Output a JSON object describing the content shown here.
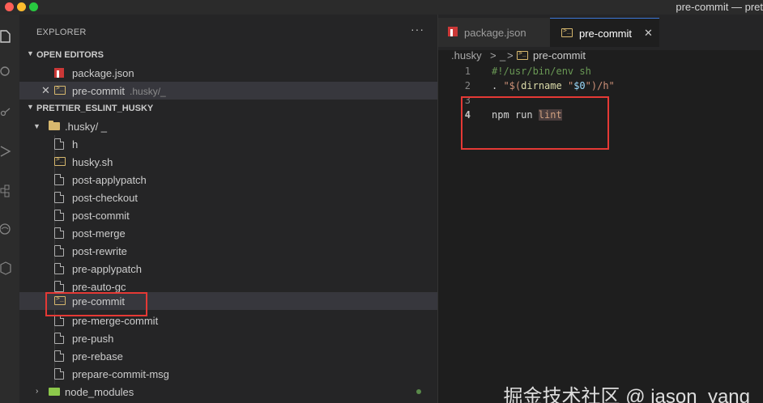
{
  "window": {
    "title": "pre-commit — pret"
  },
  "sidebar": {
    "header": "EXPLORER",
    "more_label": "···",
    "open_editors_label": "OPEN EDITORS",
    "open_editors": [
      {
        "name": "package.json",
        "icon": "npm-icon",
        "description": ""
      },
      {
        "name": "pre-commit",
        "icon": "terminal-file-icon",
        "description": ".husky/_"
      }
    ],
    "workspace_label": "PRETTIER_ESLINT_HUSKY",
    "folder": {
      "name": ".husky",
      "path_suffix": "/ _"
    },
    "files": [
      {
        "name": "h",
        "icon": "file-icon"
      },
      {
        "name": "husky.sh",
        "icon": "terminal-file-icon"
      },
      {
        "name": "post-applypatch",
        "icon": "file-icon"
      },
      {
        "name": "post-checkout",
        "icon": "file-icon"
      },
      {
        "name": "post-commit",
        "icon": "file-icon"
      },
      {
        "name": "post-merge",
        "icon": "file-icon"
      },
      {
        "name": "post-rewrite",
        "icon": "file-icon"
      },
      {
        "name": "pre-applypatch",
        "icon": "file-icon"
      },
      {
        "name": "pre-auto-gc",
        "icon": "file-icon"
      },
      {
        "name": "pre-commit",
        "icon": "terminal-file-icon"
      },
      {
        "name": "pre-merge-commit",
        "icon": "file-icon"
      },
      {
        "name": "pre-push",
        "icon": "file-icon"
      },
      {
        "name": "pre-rebase",
        "icon": "file-icon"
      },
      {
        "name": "prepare-commit-msg",
        "icon": "file-icon"
      }
    ],
    "node_modules": "node_modules"
  },
  "editor": {
    "tabs": [
      {
        "label": "package.json",
        "icon": "npm-icon",
        "active": false
      },
      {
        "label": "pre-commit",
        "icon": "terminal-file-icon",
        "active": true
      }
    ],
    "breadcrumb": {
      "folder": ".husky",
      "sep1": ">",
      "sub": "_",
      "sep2": ">",
      "file": "pre-commit"
    },
    "lines": [
      {
        "n": "1",
        "text": "#!/usr/bin/env sh"
      },
      {
        "n": "2",
        "dot": ". ",
        "q1": "\"$(",
        "fn": "dirname",
        "sp": " ",
        "q2": "\"",
        "var": "$0",
        "q3": "\")/h\""
      },
      {
        "n": "3"
      },
      {
        "n": "4",
        "kw": "npm run ",
        "arg": "lint"
      }
    ]
  },
  "watermark": "掘金技术社区 @ jason_yang"
}
